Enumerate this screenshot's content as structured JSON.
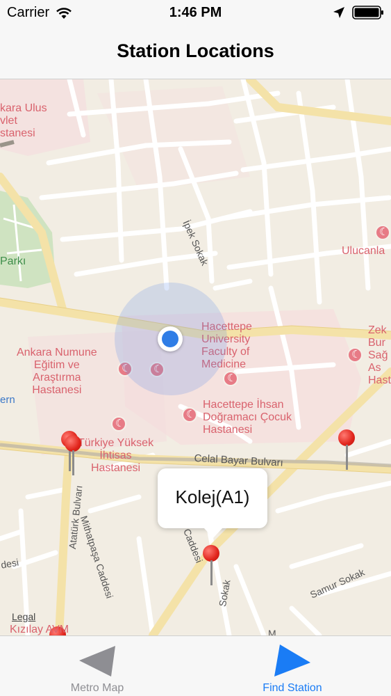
{
  "status_bar": {
    "carrier": "Carrier",
    "time": "1:46 PM",
    "icons": [
      "wifi-icon",
      "location-arrow-icon",
      "battery-icon"
    ]
  },
  "nav": {
    "title": "Station Locations"
  },
  "map": {
    "hospital_labels": {
      "ulus": "kara Ulus\nvlet\nstanesi",
      "hacettepe_univ": "Hacettepe\nUniversity\nFaculty of\nMedicine",
      "numune": "Ankara Numune\nEğitim ve\nAraştırma\nHastanesi",
      "ihsan": "Hacettepe İhsan\nDoğramacı Çocuk\nHastanesi",
      "yuksek": "Türkiye Yüksek\nİhtisas\nHastanesi",
      "ulucanlar": "Ulucanla",
      "zekai": "Zek\nBur\nSağ\nAs\nHast"
    },
    "park_label": "Parkı",
    "water_label": "ern",
    "streets": {
      "ipek": "İpek Sokak",
      "celal": "Celal Bayar Bulvarı",
      "ataturk": "Atatürk Bulvarı",
      "mithatpasa": "Mithatpaşa Caddesi",
      "cadd": "ı Caddesi",
      "samur": "Samur Sokak",
      "sokak2": "Sokak",
      "desi": "desi",
      "m": "M"
    },
    "legal": "Legal",
    "kizilay": "Kızılay AVM",
    "callout_title": "Kolej(A1)"
  },
  "tabs": [
    {
      "label": "Metro Map",
      "icon": "triangle-left-icon",
      "selected": false
    },
    {
      "label": "Find Station",
      "icon": "triangle-right-icon",
      "selected": true
    }
  ],
  "colors": {
    "accent": "#1a7cf5",
    "inactive_tab": "#8e8e93",
    "pin": "#e0241b",
    "user_location": "#2f7de6",
    "hospital_text": "#d9626d"
  }
}
